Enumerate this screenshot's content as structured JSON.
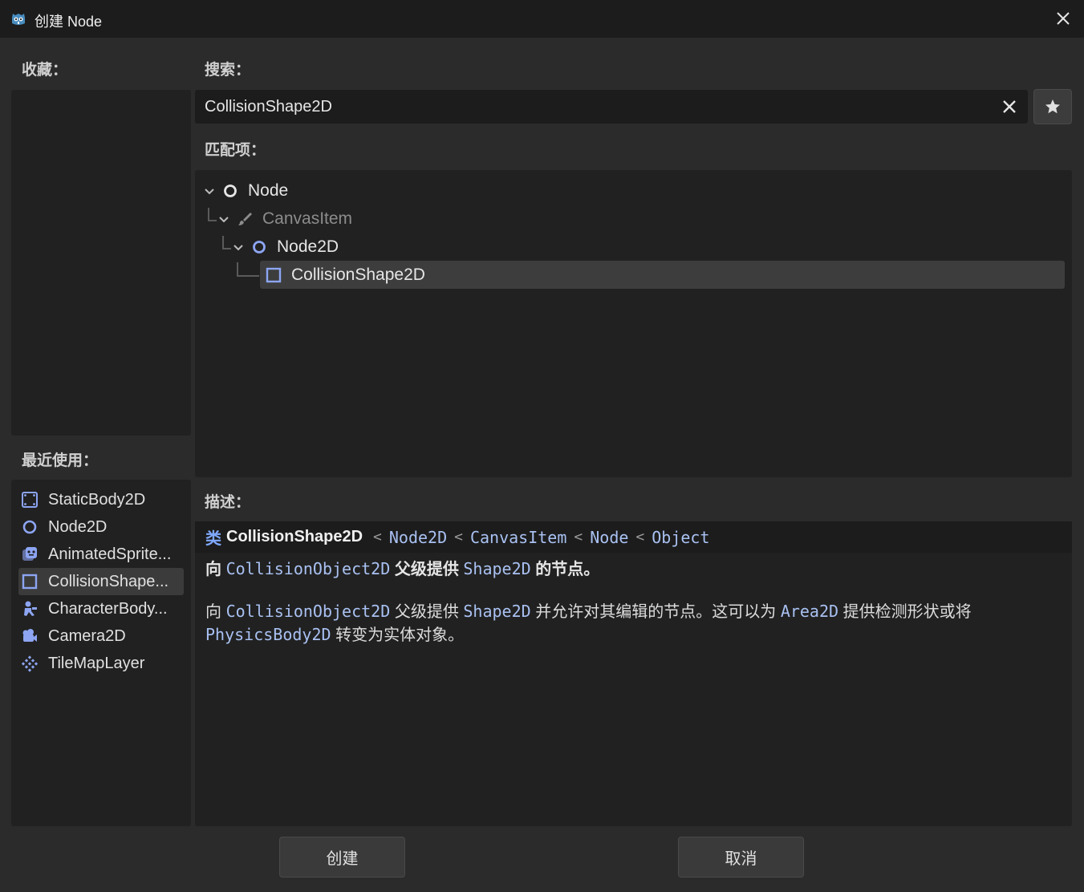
{
  "window": {
    "title": "创建 Node",
    "accent_color": "#478cbf"
  },
  "favorites": {
    "label": "收藏："
  },
  "recent": {
    "label": "最近使用：",
    "items": [
      {
        "label": "StaticBody2D",
        "icon": "static-body-2d-icon"
      },
      {
        "label": "Node2D",
        "icon": "node-2d-icon"
      },
      {
        "label": "AnimatedSprite...",
        "icon": "animated-sprite-icon"
      },
      {
        "label": "CollisionShape...",
        "icon": "collision-shape-icon",
        "selected": true
      },
      {
        "label": "CharacterBody...",
        "icon": "character-body-icon"
      },
      {
        "label": "Camera2D",
        "icon": "camera-2d-icon"
      },
      {
        "label": "TileMapLayer",
        "icon": "tile-map-layer-icon"
      }
    ]
  },
  "search": {
    "label": "搜索：",
    "value": "CollisionShape2D"
  },
  "matches": {
    "label": "匹配项：",
    "tree": [
      {
        "label": "Node",
        "icon": "node-icon",
        "depth": 0,
        "expanded": true
      },
      {
        "label": "CanvasItem",
        "icon": "canvas-item-icon",
        "depth": 1,
        "expanded": true,
        "disabled": true
      },
      {
        "label": "Node2D",
        "icon": "node-2d-icon",
        "depth": 2,
        "expanded": true
      },
      {
        "label": "CollisionShape2D",
        "icon": "collision-shape-icon",
        "depth": 3,
        "selected": true
      }
    ]
  },
  "description": {
    "label": "描述：",
    "kind": "类",
    "class_name": "CollisionShape2D",
    "inherits": [
      "Node2D",
      "CanvasItem",
      "Node",
      "Object"
    ],
    "inherit_sep": "<",
    "brief": {
      "p1": "向",
      "link1": "CollisionObject2D",
      "p2": "父级提供",
      "link2": "Shape2D",
      "p3": "的节点。"
    },
    "full": {
      "p1": "向",
      "link1": "CollisionObject2D",
      "p2": "父级提供",
      "link2": "Shape2D",
      "p3": "并允许对其编辑的节点。这可以为",
      "link3": "Area2D",
      "p4": "提供检测形状或将",
      "link4": "PhysicsBody2D",
      "p5": "转变为实体对象。"
    }
  },
  "buttons": {
    "create": "创建",
    "cancel": "取消"
  }
}
